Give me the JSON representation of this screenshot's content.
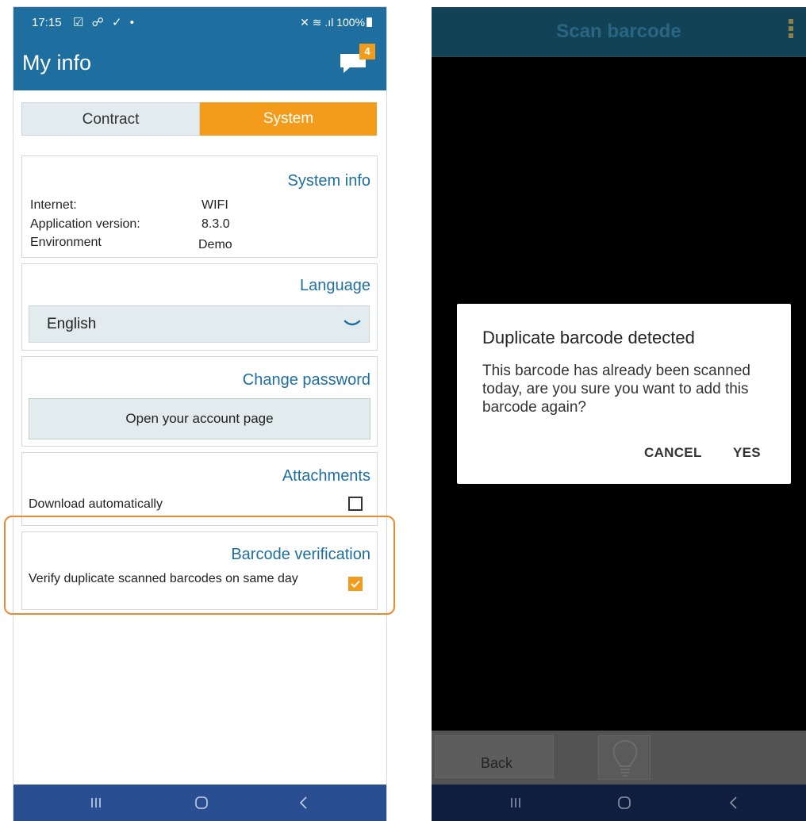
{
  "left_phone": {
    "status_bar": {
      "time": "17:15",
      "left_icons": "☑ ☍ ✓ •",
      "right_icons": "✕ ≋ .ıl 100%"
    },
    "app_bar": {
      "title": "My info",
      "chat_badge": "4"
    },
    "tabs": [
      {
        "label": "Contract",
        "active": false
      },
      {
        "label": "System",
        "active": true
      }
    ],
    "system_info": {
      "title": "System info",
      "rows": [
        {
          "label": "Internet:",
          "value": "WIFI"
        },
        {
          "label": "Application version:",
          "value": "8.3.0"
        },
        {
          "label": "Environment",
          "value": "Demo"
        }
      ]
    },
    "language": {
      "title": "Language",
      "selected": "English"
    },
    "password": {
      "title": "Change password",
      "button_label": "Open your account page"
    },
    "attachments": {
      "title": "Attachments",
      "option_label": "Download automatically",
      "checked": false
    },
    "barcode": {
      "title": "Barcode verification",
      "option_label": "Verify duplicate scanned barcodes on same day",
      "checked": true
    }
  },
  "right_phone": {
    "header_title": "Scan barcode",
    "back_label": "Back",
    "dialog": {
      "title": "Duplicate barcode detected",
      "message": "This barcode has already been scanned today, are you sure you want to add this barcode again?",
      "cancel_label": "CANCEL",
      "yes_label": "YES"
    }
  },
  "colors": {
    "brand_blue": "#1e6f9f",
    "accent_orange": "#f39c1c",
    "nav_blue": "#2a4e92"
  }
}
